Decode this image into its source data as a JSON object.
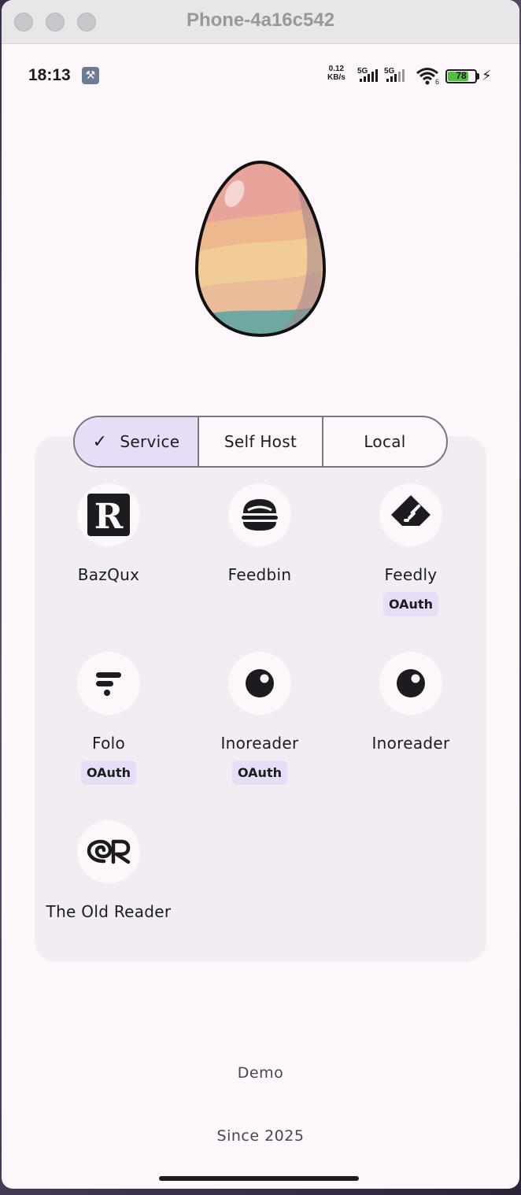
{
  "window": {
    "title": "Phone-4a16c542"
  },
  "statusbar": {
    "time": "18:13",
    "net_speed_value": "0.12",
    "net_speed_unit": "KB/s",
    "sig1_label": "5G",
    "sig2_label": "5G",
    "wifi_sub": "6",
    "battery_percent": "78",
    "battery_level": 0.78
  },
  "tabs": {
    "items": [
      {
        "label": "Service",
        "selected": true
      },
      {
        "label": "Self Host",
        "selected": false
      },
      {
        "label": "Local",
        "selected": false
      }
    ]
  },
  "services": [
    {
      "name": "BazQux",
      "icon": "bazqux-icon",
      "badge": ""
    },
    {
      "name": "Feedbin",
      "icon": "feedbin-icon",
      "badge": ""
    },
    {
      "name": "Feedly",
      "icon": "feedly-icon",
      "badge": "OAuth"
    },
    {
      "name": "Folo",
      "icon": "folo-icon",
      "badge": "OAuth"
    },
    {
      "name": "Inoreader",
      "icon": "inoreader-icon",
      "badge": "OAuth"
    },
    {
      "name": "Inoreader",
      "icon": "inoreader-icon",
      "badge": ""
    },
    {
      "name": "The Old Reader",
      "icon": "old-reader-icon",
      "badge": ""
    }
  ],
  "footer": {
    "demo_label": "Demo",
    "since_label": "Since 2025"
  },
  "colors": {
    "background": "#fdf7fb",
    "panel": "#f2ecf3",
    "selected": "#e6def6",
    "text": "#1c1b1f"
  }
}
